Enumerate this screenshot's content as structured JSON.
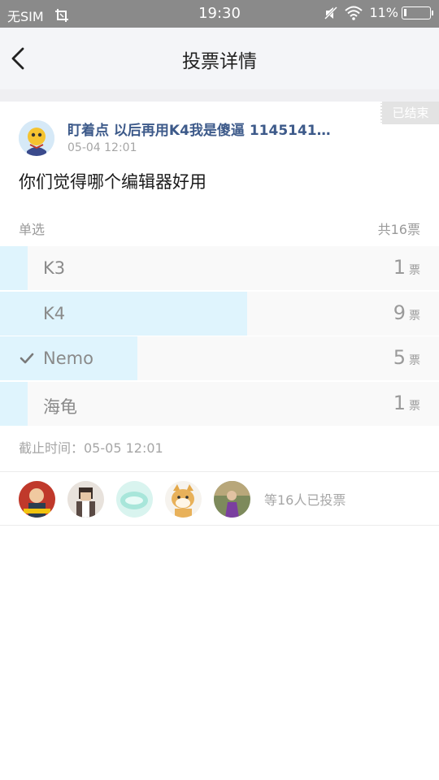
{
  "status_bar": {
    "carrier": "无SIM",
    "time": "19:30",
    "battery": "11%",
    "battery_level": 0.11
  },
  "nav": {
    "title": "投票详情",
    "back_icon": "chevron-left-icon"
  },
  "post": {
    "status_tag": "已结束",
    "author": "盯着点 以后再用K4我是傻逼 1145141…",
    "time": "05-04 12:01",
    "question": "你们觉得哪个编辑器好用",
    "vote_type": "单选",
    "total_votes": "共16票",
    "options": [
      {
        "label": "K3",
        "count": "1",
        "unit": "票",
        "fraction": 0.0625,
        "selected": false
      },
      {
        "label": "K4",
        "count": "9",
        "unit": "票",
        "fraction": 0.5625,
        "selected": false
      },
      {
        "label": "Nemo",
        "count": "5",
        "unit": "票",
        "fraction": 0.3125,
        "selected": true
      },
      {
        "label": "海龟",
        "count": "1",
        "unit": "票",
        "fraction": 0.0625,
        "selected": false
      }
    ],
    "deadline": "截止时间：05-05 12:01",
    "voters_text": "等16人已投票"
  },
  "colors": {
    "accent_fill": "#dff4fd",
    "author_blue": "#3d5a8a",
    "status_bar": "#8a8a8a"
  }
}
